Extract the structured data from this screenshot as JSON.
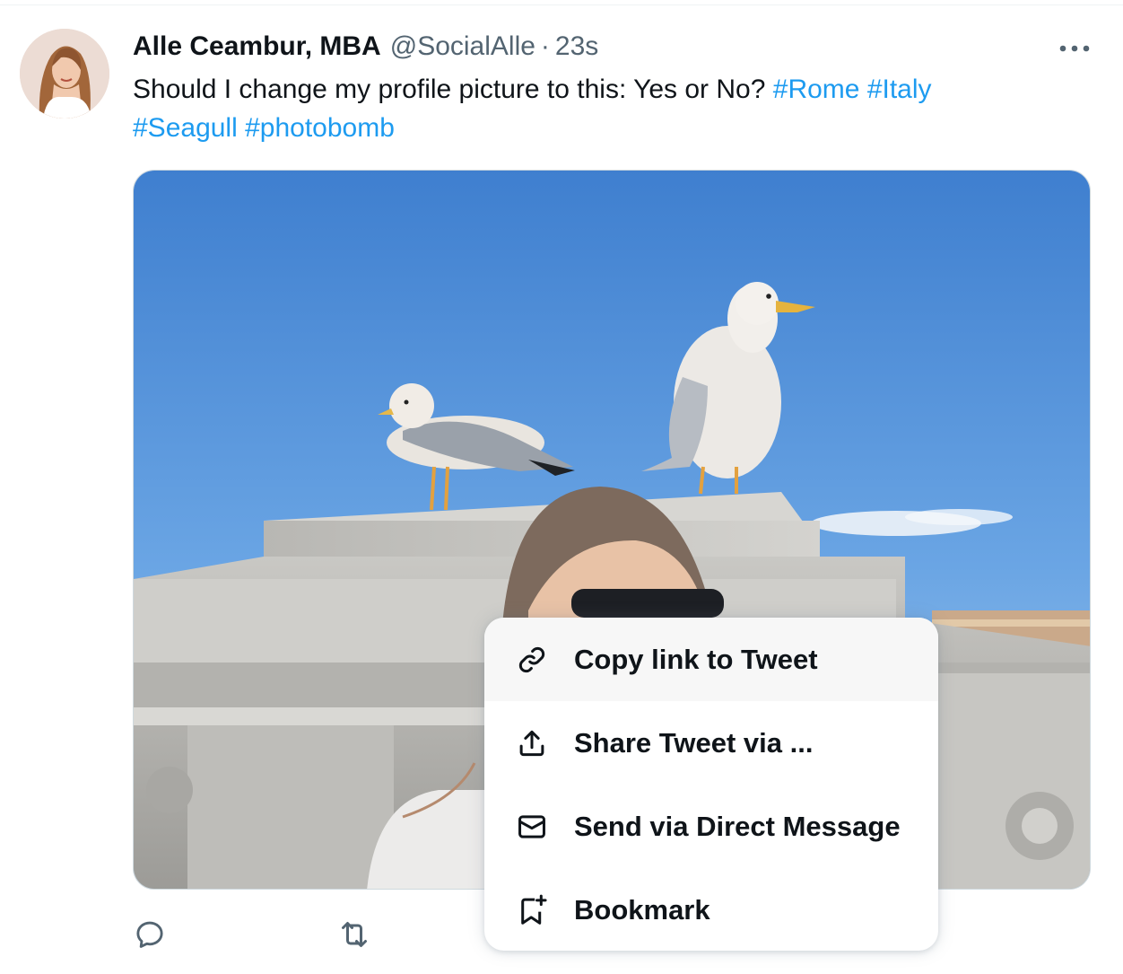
{
  "tweet": {
    "author_name": "Alle Ceambur, MBA",
    "author_handle": "@SocialAlle",
    "separator": "·",
    "timestamp": "23s",
    "text": "Should I change my profile picture to this: Yes or No?",
    "hashtags": [
      "#Rome",
      "#Italy",
      "#Seagull",
      "#photobomb"
    ],
    "more_icon": "ellipsis-icon",
    "media_description_icon": "photo"
  },
  "actions": [
    {
      "icon": "reply-icon"
    },
    {
      "icon": "retweet-icon"
    }
  ],
  "share_menu": {
    "items": [
      {
        "label": "Copy link to Tweet",
        "icon": "link-icon",
        "highlighted": true
      },
      {
        "label": "Share Tweet via ...",
        "icon": "upload-icon",
        "highlighted": false
      },
      {
        "label": "Send via Direct Message",
        "icon": "envelope-icon",
        "highlighted": false
      },
      {
        "label": "Bookmark",
        "icon": "bookmark-add-icon",
        "highlighted": false
      }
    ]
  },
  "colors": {
    "text": "#0f1419",
    "secondary_text": "#536471",
    "link": "#1d9bf0",
    "menu_hover": "#f7f7f7"
  }
}
